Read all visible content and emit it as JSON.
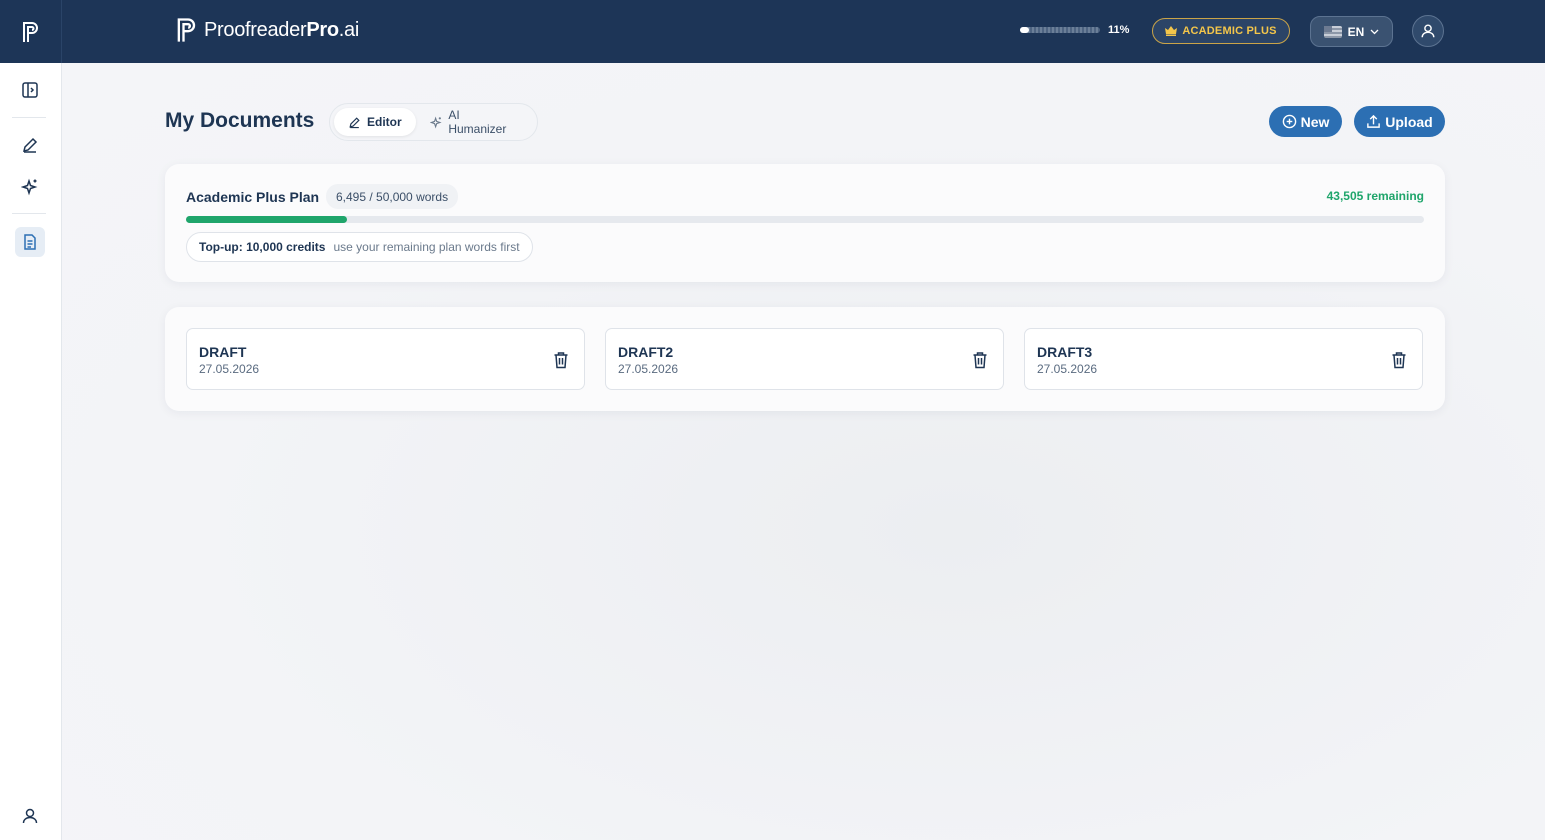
{
  "app": {
    "brand_prefix": "Proofreader",
    "brand_bold": "Pro",
    "brand_suffix": ".ai"
  },
  "topbar": {
    "usage_percent_label": "11%",
    "usage_fraction": 0.11,
    "plan_badge": "ACADEMIC PLUS",
    "language": "EN",
    "icons": [
      "crown-icon",
      "flag-icon",
      "chevron-down-icon",
      "user-icon"
    ]
  },
  "sidebar": {
    "items": [
      {
        "name": "toggle-sidebar",
        "icon": "panel-icon"
      },
      {
        "name": "editor",
        "icon": "pencil-icon"
      },
      {
        "name": "ai-humanizer",
        "icon": "sparkles-icon"
      },
      {
        "name": "documents",
        "icon": "document-icon",
        "active": true
      },
      {
        "name": "account",
        "icon": "user-icon"
      }
    ]
  },
  "main": {
    "title": "My Documents",
    "tabs": [
      {
        "label": "Editor",
        "icon": "pencil-icon",
        "active": true
      },
      {
        "label": "AI Humanizer",
        "icon": "sparkles-icon",
        "active": false
      }
    ],
    "new_label": "New",
    "upload_label": "Upload"
  },
  "plan": {
    "name": "Academic Plus Plan",
    "words": "6,495 / 50,000 words",
    "remaining": "43,505 remaining",
    "used_fraction": 0.13,
    "topup_label": "Top-up: 10,000 credits",
    "topup_note": "use your remaining plan words first"
  },
  "documents": [
    {
      "name": "DRAFT",
      "date": "27.05.2026"
    },
    {
      "name": "DRAFT2",
      "date": "27.05.2026"
    },
    {
      "name": "DRAFT3",
      "date": "27.05.2026"
    }
  ],
  "colors": {
    "navy": "#1d3557",
    "primary": "#2c6fb3",
    "success": "#1fa56b",
    "gold": "#f4c64a"
  }
}
